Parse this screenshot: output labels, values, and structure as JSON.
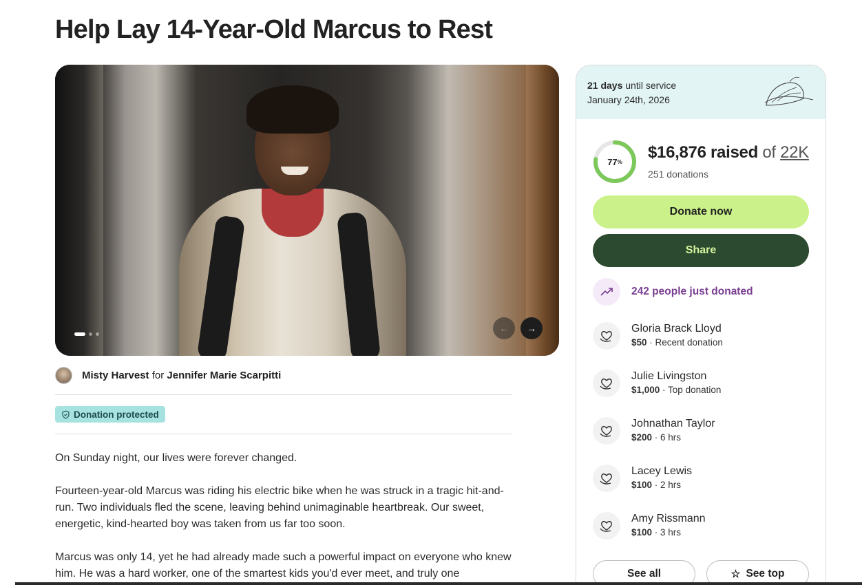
{
  "page": {
    "title": "Help Lay 14-Year-Old Marcus to Rest"
  },
  "organizer": {
    "name": "Misty Harvest",
    "connector": "for",
    "beneficiary": "Jennifer Marie Scarpitti"
  },
  "badge": {
    "label": "Donation protected"
  },
  "story": {
    "paragraphs": [
      "On Sunday night, our lives were forever changed.",
      "Fourteen-year-old Marcus was riding his electric bike when he was struck in a tragic hit-and-run. Two individuals fled the scene, leaving behind unimaginable heartbreak. Our sweet, energetic, kind-hearted boy was taken from us far too soon.",
      "Marcus was only 14, yet he had already made such a powerful impact on everyone who knew him. He was a hard worker, one of the smartest kids you'd ever meet, and truly one"
    ]
  },
  "service": {
    "days": "21 days",
    "suffix": "until service",
    "date": "January 24th, 2026"
  },
  "fundraiser": {
    "raised": "$16,876 raised",
    "of": "of",
    "goal": "22K",
    "percent_label": "77",
    "percent_sign": "%",
    "progress_fraction": 0.77,
    "donations": "251 donations"
  },
  "actions": {
    "donate": "Donate now",
    "share": "Share",
    "see_all": "See all",
    "see_top": "See top"
  },
  "trend": {
    "text": "242 people just donated"
  },
  "donors": [
    {
      "name": "Gloria Brack Lloyd",
      "amount": "$50",
      "note": " · Recent donation"
    },
    {
      "name": "Julie Livingston",
      "amount": "$1,000",
      "note": " · Top donation"
    },
    {
      "name": "Johnathan Taylor",
      "amount": "$200",
      "note": " · 6 hrs"
    },
    {
      "name": "Lacey Lewis",
      "amount": "$100",
      "note": " · 2 hrs"
    },
    {
      "name": "Amy Rissmann",
      "amount": "$100",
      "note": " · 3 hrs"
    }
  ],
  "colors": {
    "donate_bg": "#cbf28a",
    "share_bg": "#2c4a2f",
    "progress_ring": "#7cc85a",
    "trend_text": "#7a3e92",
    "badge_bg": "#a6e3e0"
  },
  "icons": {
    "carousel_prev": "arrow-left-icon",
    "carousel_next": "arrow-right-icon",
    "badge": "shield-icon",
    "trend": "trending-up-icon",
    "donor": "heart-hand-icon",
    "see_top": "star-icon",
    "decoration": "leaf-icon"
  }
}
